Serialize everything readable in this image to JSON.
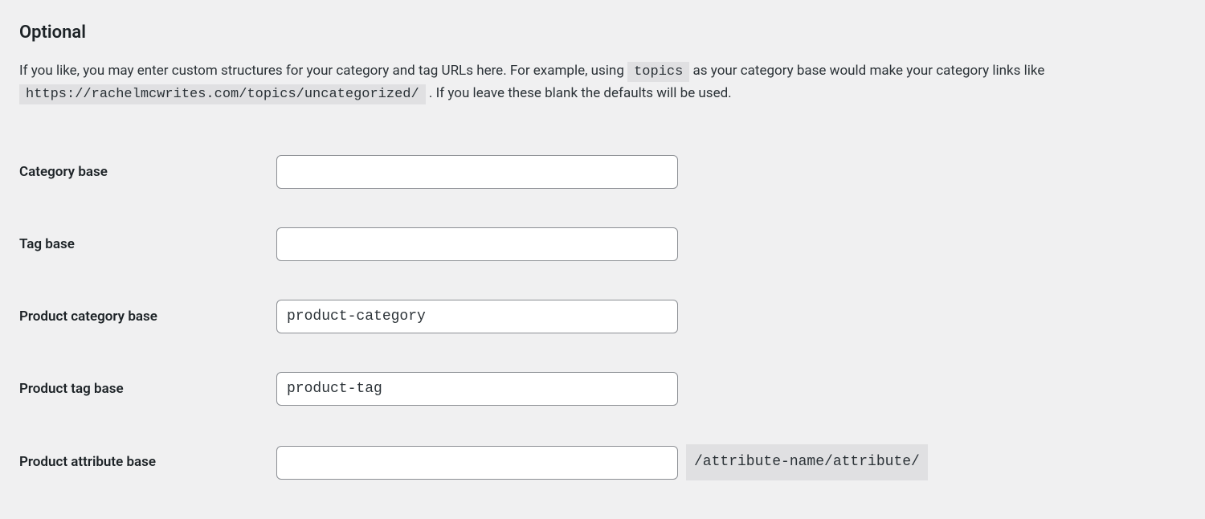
{
  "section": {
    "heading": "Optional",
    "description_pre": "If you like, you may enter custom structures for your category and tag URLs here. For example, using ",
    "description_code1": "topics",
    "description_mid": " as your category base would make your category links like ",
    "description_code2": "https://rachelmcwrites.com/topics/uncategorized/",
    "description_post": " . If you leave these blank the defaults will be used."
  },
  "fields": {
    "category_base": {
      "label": "Category base",
      "value": ""
    },
    "tag_base": {
      "label": "Tag base",
      "value": ""
    },
    "product_category_base": {
      "label": "Product category base",
      "value": "product-category"
    },
    "product_tag_base": {
      "label": "Product tag base",
      "value": "product-tag"
    },
    "product_attribute_base": {
      "label": "Product attribute base",
      "value": "",
      "suffix": "/attribute-name/attribute/"
    }
  }
}
